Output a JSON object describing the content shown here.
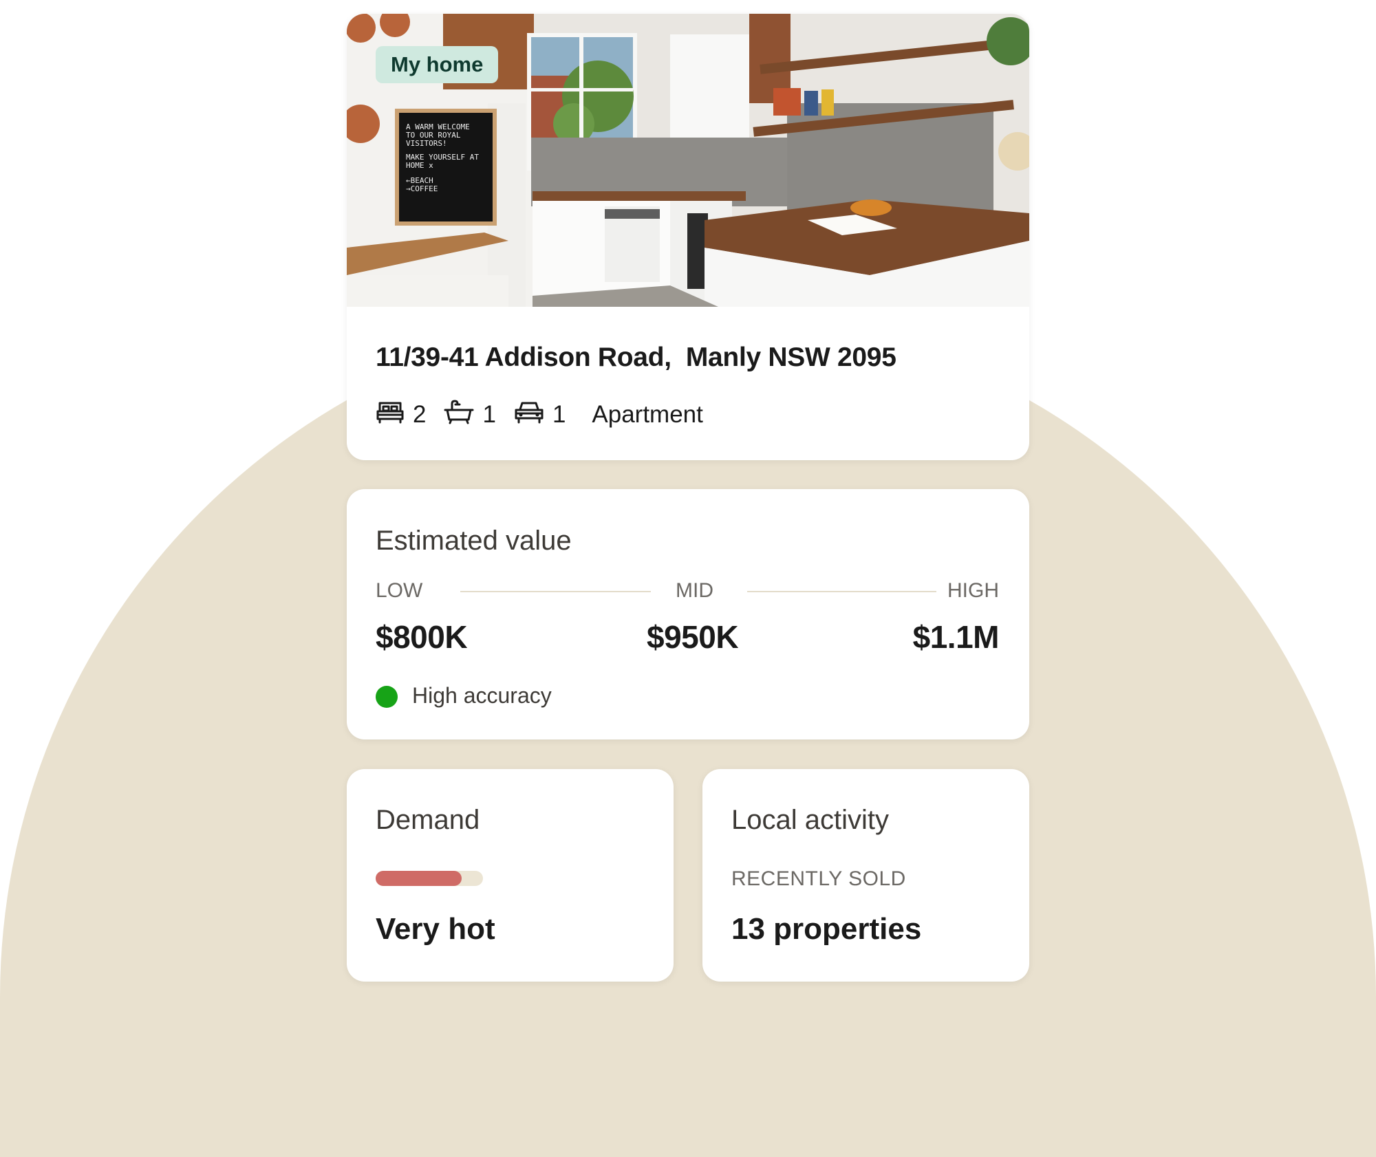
{
  "colors": {
    "background_arch": "#e9e1cf",
    "badge_bg": "#cfe9df",
    "accuracy_dot": "#17a317",
    "demand_fill": "#cf6b66",
    "demand_track": "#ece5d4"
  },
  "property": {
    "badge": "My home",
    "photo": "kitchen-photo",
    "address_street": "11/39-41 Addison Road,",
    "address_suburb": "Manly NSW 2095",
    "features": [
      {
        "icon": "bed-icon",
        "value": "2"
      },
      {
        "icon": "bath-icon",
        "value": "1"
      },
      {
        "icon": "car-icon",
        "value": "1"
      }
    ],
    "type": "Apartment",
    "letterboard": [
      "A WARM  WELCOME",
      "TO  OUR  ROYAL",
      "VISITORS!",
      "MAKE YOURSELF AT",
      "HOME x",
      "←BEACH",
      "→COFFEE"
    ]
  },
  "estimate": {
    "title": "Estimated value",
    "low_label": "LOW",
    "mid_label": "MID",
    "high_label": "HIGH",
    "low_value": "$800K",
    "mid_value": "$950K",
    "high_value": "$1.1M",
    "accuracy": "High accuracy"
  },
  "demand": {
    "title": "Demand",
    "level": 0.8,
    "label": "Very hot"
  },
  "activity": {
    "title": "Local activity",
    "sublabel": "RECENTLY SOLD",
    "value": "13 properties"
  }
}
